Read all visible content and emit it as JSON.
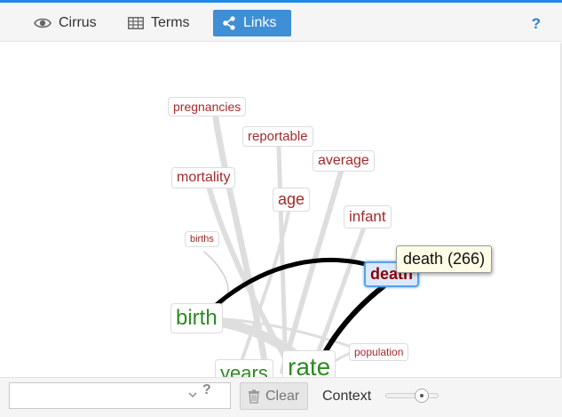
{
  "tabs": [
    {
      "label": "Cirrus",
      "icon": "eye-icon",
      "active": false
    },
    {
      "label": "Terms",
      "icon": "table-icon",
      "active": false
    },
    {
      "label": "Links",
      "icon": "share-icon",
      "active": true
    }
  ],
  "header": {
    "help": "?"
  },
  "graph": {
    "context_terms": [
      "pregnancies",
      "reportable",
      "average",
      "mortality",
      "age",
      "infant",
      "births",
      "population"
    ],
    "keywords": [
      "birth",
      "years",
      "rate"
    ],
    "selected": "death",
    "tooltip": "death (266)"
  },
  "bottom": {
    "search_value": "",
    "help": "?",
    "clear_label": "Clear",
    "context_label": "Context",
    "context_level": 0.75
  },
  "colors": {
    "accent": "#3f8fd6",
    "context_term": "#a52a2a",
    "keyword": "#2e8b22",
    "selected": "#8b0000"
  }
}
